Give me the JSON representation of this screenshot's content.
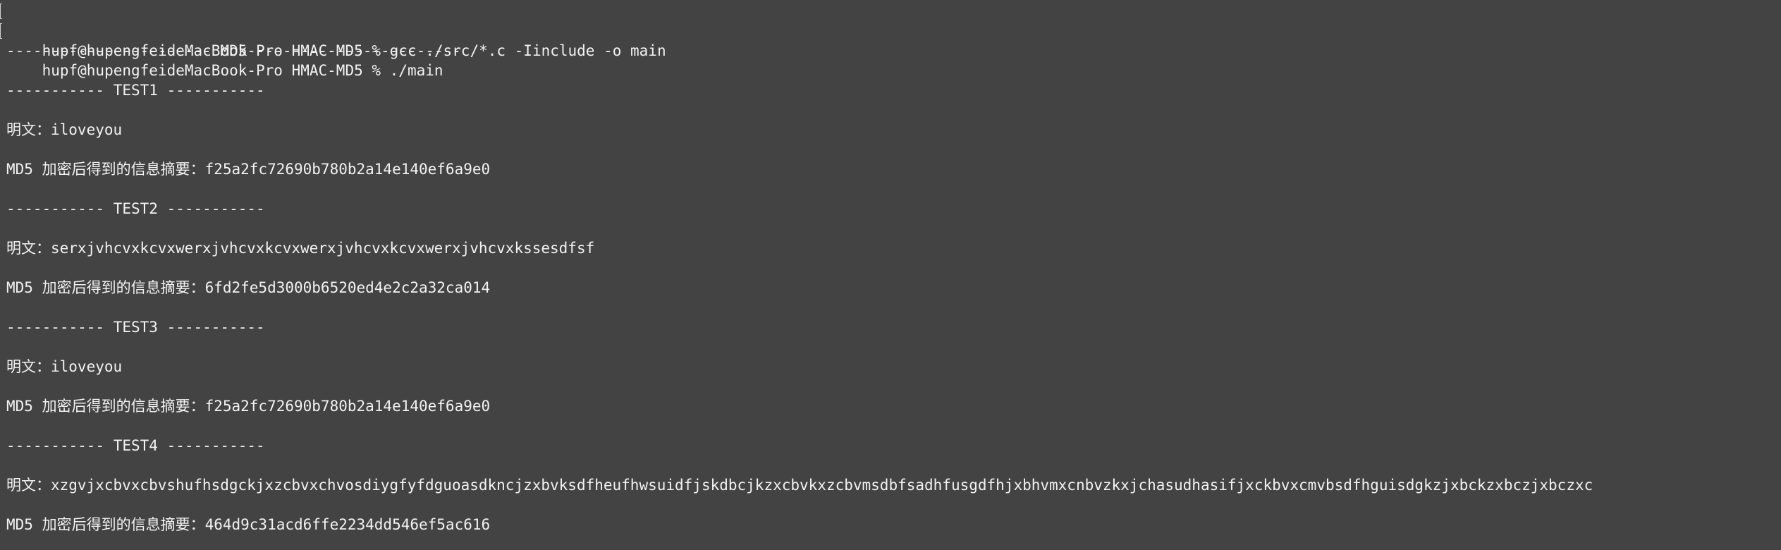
{
  "terminal": {
    "lines": [
      {
        "kind": "prompt",
        "text": "hupf@hupengfeideMacBook-Pro HMAC-MD5 % gcc ./src/*.c -Iinclude -o main"
      },
      {
        "kind": "prompt",
        "text": "hupf@hupengfeideMacBook-Pro HMAC-MD5 % ./main"
      },
      {
        "kind": "output",
        "text": "----------------------- MD5 -----------------------"
      },
      {
        "kind": "blank",
        "text": ""
      },
      {
        "kind": "output",
        "text": "----------- TEST1 -----------"
      },
      {
        "kind": "blank",
        "text": ""
      },
      {
        "kind": "output",
        "text": "明文：iloveyou"
      },
      {
        "kind": "blank",
        "text": ""
      },
      {
        "kind": "output",
        "text": "MD5 加密后得到的信息摘要：f25a2fc72690b780b2a14e140ef6a9e0"
      },
      {
        "kind": "blank",
        "text": ""
      },
      {
        "kind": "output",
        "text": "----------- TEST2 -----------"
      },
      {
        "kind": "blank",
        "text": ""
      },
      {
        "kind": "output",
        "text": "明文：serxjvhcvxkcvxwerxjvhcvxkcvxwerxjvhcvxkcvxwerxjvhcvxkssesdfsf"
      },
      {
        "kind": "blank",
        "text": ""
      },
      {
        "kind": "output",
        "text": "MD5 加密后得到的信息摘要：6fd2fe5d3000b6520ed4e2c2a32ca014"
      },
      {
        "kind": "blank",
        "text": ""
      },
      {
        "kind": "output",
        "text": "----------- TEST3 -----------"
      },
      {
        "kind": "blank",
        "text": ""
      },
      {
        "kind": "output",
        "text": "明文：iloveyou"
      },
      {
        "kind": "blank",
        "text": ""
      },
      {
        "kind": "output",
        "text": "MD5 加密后得到的信息摘要：f25a2fc72690b780b2a14e140ef6a9e0"
      },
      {
        "kind": "blank",
        "text": ""
      },
      {
        "kind": "output",
        "text": "----------- TEST4 -----------"
      },
      {
        "kind": "blank",
        "text": ""
      },
      {
        "kind": "output",
        "text": "明文：xzgvjxcbvxcbvshufhsdgckjxzcbvxchvosdiygfyfdguoasdkncjzxbvksdfheufhwsuidfjskdbcjkzxcbvkxzcbvmsdbfsadhfusgdfhjxbhvmxcnbvzkxjchasudhasifjxckbvxcmvbsdfhguisdgkzjxbckzxbczjxbczxc"
      },
      {
        "kind": "blank",
        "text": ""
      },
      {
        "kind": "output",
        "text": "MD5 加密后得到的信息摘要：464d9c31acd6ffe2234dd546ef5ac616"
      }
    ]
  },
  "colors": {
    "background": "#434343",
    "foreground": "#f2f2f2"
  }
}
